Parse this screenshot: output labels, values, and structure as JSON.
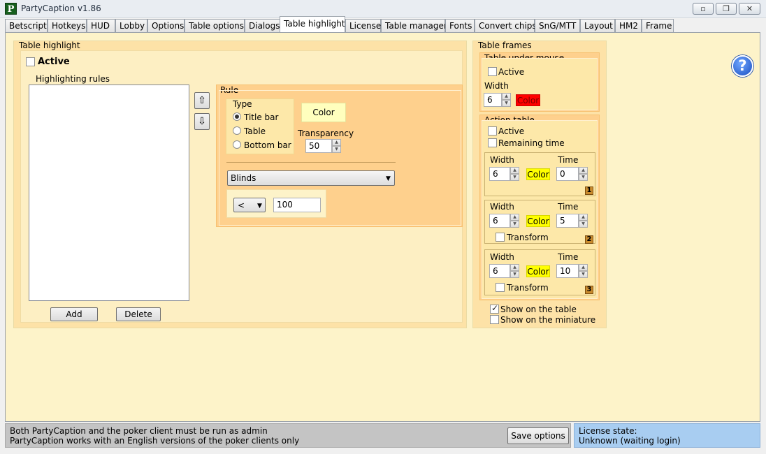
{
  "window": {
    "title": "PartyCaption v1.86",
    "icon_letter": "P"
  },
  "tabs": [
    {
      "label": "Betscript"
    },
    {
      "label": "Hotkeys"
    },
    {
      "label": "HUD"
    },
    {
      "label": "Lobby"
    },
    {
      "label": "Options"
    },
    {
      "label": "Table options"
    },
    {
      "label": "Dialogs"
    },
    {
      "label": "Table highlight",
      "active": true
    },
    {
      "label": "License"
    },
    {
      "label": "Table manager"
    },
    {
      "label": "Fonts"
    },
    {
      "label": "Convert chips"
    },
    {
      "label": "SnG/MTT"
    },
    {
      "label": "Layout"
    },
    {
      "label": "HM2"
    },
    {
      "label": "Frame"
    }
  ],
  "highlight": {
    "title": "Table highlight",
    "active_label": "Active",
    "active_checked": false,
    "rules_label": "Highlighting rules",
    "add_label": "Add",
    "delete_label": "Delete",
    "rule": {
      "title": "Rule",
      "type_title": "Type",
      "types": [
        {
          "label": "Title bar",
          "checked": true
        },
        {
          "label": "Table",
          "checked": false
        },
        {
          "label": "Bottom bar",
          "checked": false
        }
      ],
      "color_label": "Color",
      "color_value": "#ffffbe",
      "transparency_label": "Transparency",
      "transparency_value": "50",
      "condition_select": "Blinds",
      "operator_select": "<",
      "threshold_value": "100"
    }
  },
  "frames": {
    "title": "Table frames",
    "under_mouse": {
      "title": "Table under mouse",
      "active_label": "Active",
      "active_checked": false,
      "width_label": "Width",
      "width_value": "6",
      "color_label": "Color",
      "color_value": "#ff0000"
    },
    "action": {
      "title": "Action table",
      "active_label": "Active",
      "active_checked": false,
      "remaining_label": "Remaining time",
      "remaining_checked": false,
      "steps": [
        {
          "width_label": "Width",
          "width_value": "6",
          "color_label": "Color",
          "color_value": "#ffff00",
          "time_label": "Time",
          "time_value": "0",
          "badge": "1"
        },
        {
          "width_label": "Width",
          "width_value": "6",
          "color_label": "Color",
          "color_value": "#ffff00",
          "time_label": "Time",
          "time_value": "5",
          "transform_label": "Transform",
          "transform_checked": false,
          "badge": "2"
        },
        {
          "width_label": "Width",
          "width_value": "6",
          "color_label": "Color",
          "color_value": "#ffff00",
          "time_label": "Time",
          "time_value": "10",
          "transform_label": "Transform",
          "transform_checked": false,
          "badge": "3"
        }
      ]
    },
    "show_on_table_label": "Show on the table",
    "show_on_table_checked": true,
    "show_on_miniature_label": "Show on the miniature",
    "show_on_miniature_checked": false
  },
  "status": {
    "line1": "Both PartyCaption and the poker client must be run as admin",
    "line2": "PartyCaption works with an English versions of the poker clients only",
    "save_label": "Save options"
  },
  "license": {
    "line1": "License state:",
    "line2": "Unknown (waiting login)"
  },
  "colors": {
    "pane_bg": "#fdf3c9",
    "group_bg": "#fde2a7",
    "rule_bg": "#fed08d",
    "license_bg": "#a8cdf1"
  }
}
